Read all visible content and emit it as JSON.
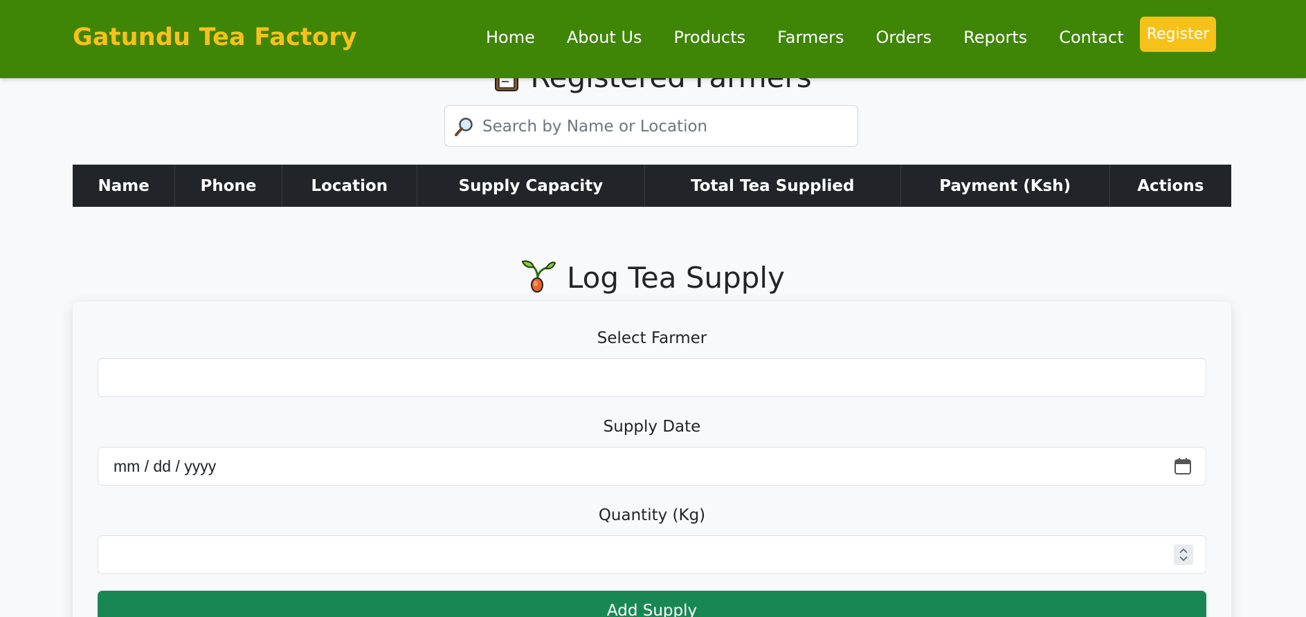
{
  "navbar": {
    "brand": "Gatundu Tea Factory",
    "links": [
      "Home",
      "About Us",
      "Products",
      "Farmers",
      "Orders",
      "Reports",
      "Contact"
    ],
    "register_label": "Register"
  },
  "farmers_section": {
    "title": "Registered Farmers",
    "search_placeholder": "Search by Name or Location",
    "table_headers": [
      "Name",
      "Phone",
      "Location",
      "Supply Capacity",
      "Total Tea Supplied",
      "Payment (Ksh)",
      "Actions"
    ]
  },
  "supply_section": {
    "title": "Log Tea Supply",
    "farmer_label": "Select Farmer",
    "date_label": "Supply Date",
    "date_placeholder": "mm / dd / yyyy",
    "quantity_label": "Quantity (Kg)",
    "submit_label": "Add Supply"
  },
  "colors": {
    "navbar_bg": "#3f8506",
    "brand": "#f6c21a",
    "register_bg": "#f6c21a",
    "table_header_bg": "#212529",
    "submit_bg": "#198754"
  }
}
